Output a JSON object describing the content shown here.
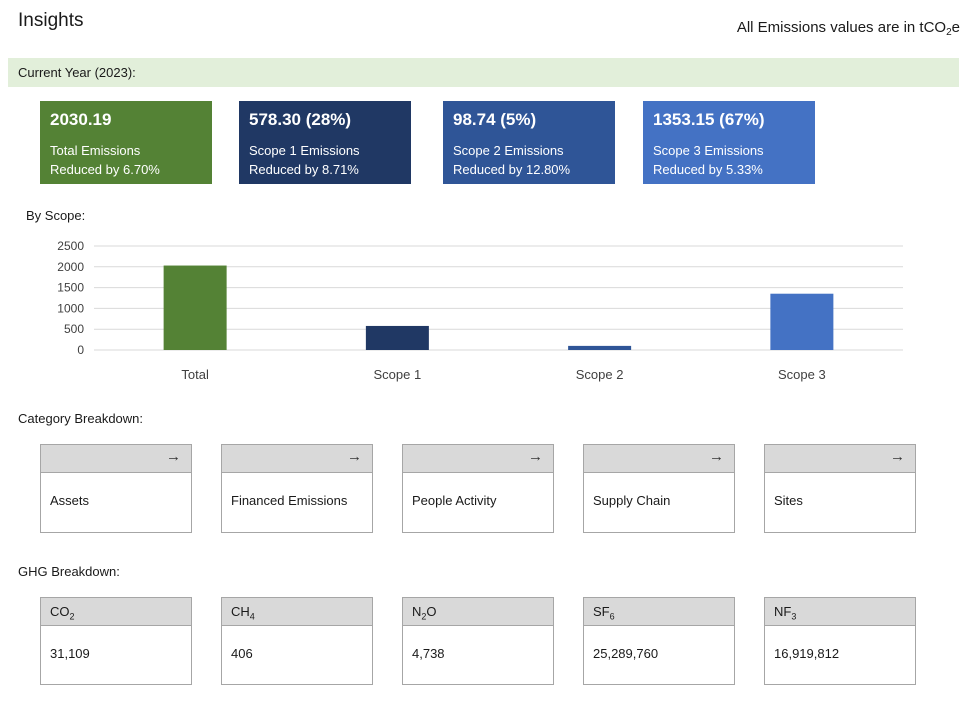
{
  "header": {
    "title": "Insights",
    "units_prefix": "All Emissions values are in tCO",
    "units_sub": "2",
    "units_suffix": "e"
  },
  "current_year_label": "Current Year (2023):",
  "kpis": [
    {
      "value": "2030.19",
      "label": "Total Emissions",
      "reduction": "Reduced by 6.70%",
      "color": "#548235"
    },
    {
      "value": "578.30 (28%)",
      "label": "Scope 1 Emissions",
      "reduction": "Reduced by 8.71%",
      "color": "#203864"
    },
    {
      "value": "98.74 (5%)",
      "label": "Scope 2 Emissions",
      "reduction": "Reduced by 12.80%",
      "color": "#2f5597"
    },
    {
      "value": "1353.15 (67%)",
      "label": "Scope 3 Emissions",
      "reduction": "Reduced by 5.33%",
      "color": "#4472c4"
    }
  ],
  "by_scope_label": "By Scope:",
  "chart_data": {
    "type": "bar",
    "categories": [
      "Total",
      "Scope 1",
      "Scope 2",
      "Scope 3"
    ],
    "values": [
      2030.19,
      578.3,
      98.74,
      1353.15
    ],
    "colors": [
      "#548235",
      "#203864",
      "#2f5597",
      "#4472c4"
    ],
    "yticks": [
      0,
      500,
      1000,
      1500,
      2000,
      2500
    ],
    "ylim": [
      0,
      2500
    ],
    "grid": true
  },
  "category_breakdown_label": "Category Breakdown:",
  "categories": [
    {
      "name": "Assets",
      "icon": "arrow-right-icon"
    },
    {
      "name": "Financed Emissions",
      "icon": "arrow-right-icon"
    },
    {
      "name": "People Activity",
      "icon": "arrow-right-icon"
    },
    {
      "name": "Supply Chain",
      "icon": "arrow-right-icon"
    },
    {
      "name": "Sites",
      "icon": "arrow-right-icon"
    }
  ],
  "ghg_breakdown_label": "GHG Breakdown:",
  "ghg": [
    {
      "gas": "CO",
      "sub": "2",
      "value": "31,109"
    },
    {
      "gas": "CH",
      "sub": "4",
      "value": "406"
    },
    {
      "gas": "N",
      "sub": "2",
      "suffix": "O",
      "value": "4,738"
    },
    {
      "gas": "SF",
      "sub": "6",
      "value": "25,289,760"
    },
    {
      "gas": "NF",
      "sub": "3",
      "value": "16,919,812"
    }
  ]
}
